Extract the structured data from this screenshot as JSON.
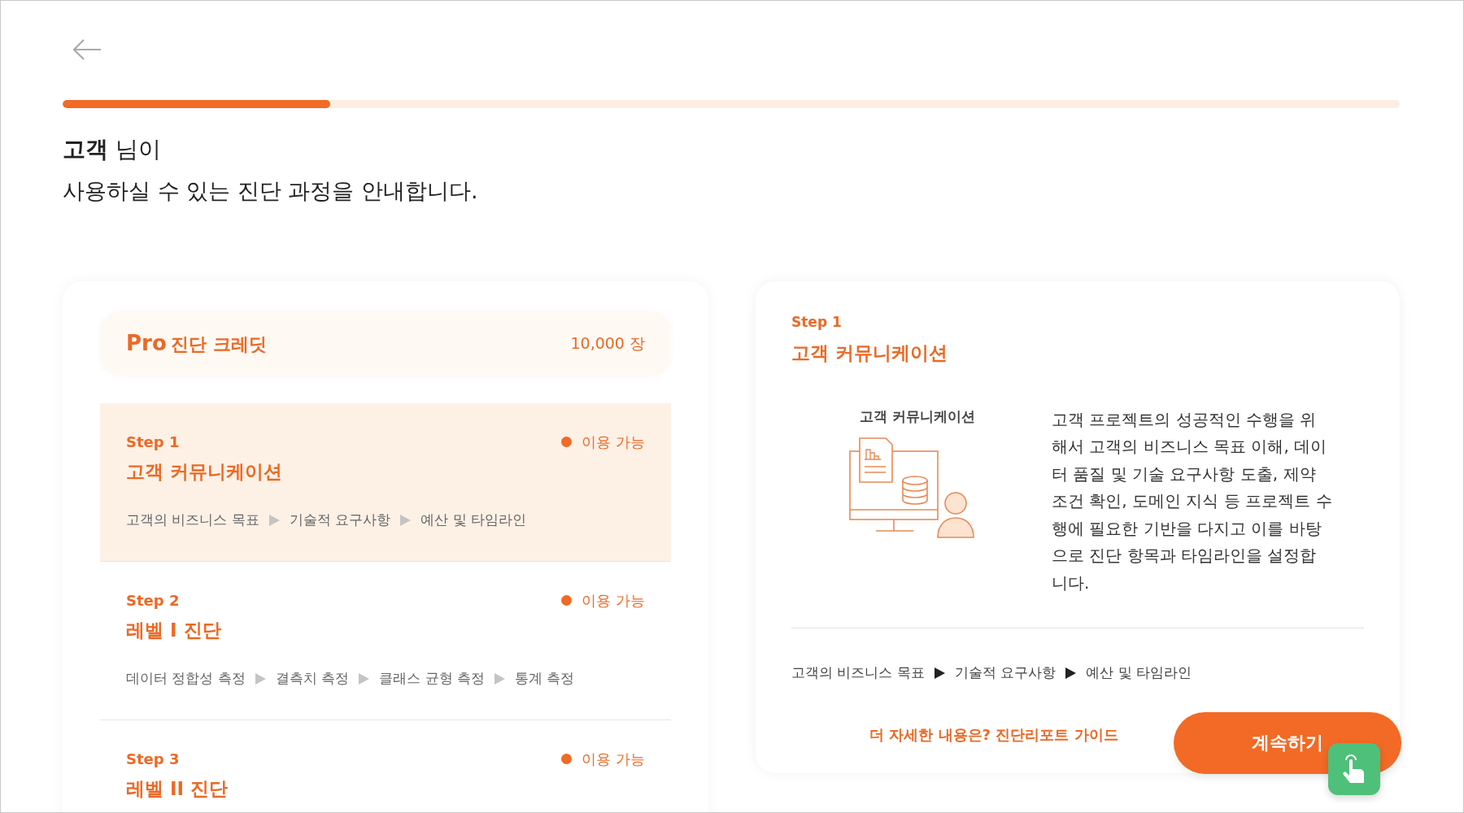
{
  "progress": {
    "level": 0.2
  },
  "greeting": {
    "name": "고객",
    "suffix": "님이",
    "subtitle": "사용하실 수 있는 진단 과정을 안내합니다."
  },
  "credit": {
    "plan": "Pro",
    "label": "진단 크레딧",
    "amount": "10,000 장"
  },
  "steps": [
    {
      "step": "Step 1",
      "title": "고객 커뮤니케이션",
      "status": "이용 가능",
      "selected": true,
      "tasks": [
        "고객의 비즈니스 목표",
        "기술적 요구사항",
        "예산 및 타임라인"
      ]
    },
    {
      "step": "Step 2",
      "title": "레벨 I 진단",
      "status": "이용 가능",
      "selected": false,
      "tasks": [
        "데이터 정합성 측정",
        "결측치 측정",
        "클래스 균형 측정",
        "통계 측정"
      ]
    },
    {
      "step": "Step 3",
      "title": "레벨 II 진단",
      "status": "이용 가능",
      "selected": false
    }
  ],
  "detail": {
    "step": "Step 1",
    "title": "고객 커뮤니케이션",
    "illustration_label": "고객 커뮤니케이션",
    "description": "고객 프로젝트의 성공적인 수행을 위해서 고객의 비즈니스 목표 이해, 데이터 품질 및 기술 요구사항 도출, 제약 조건 확인, 도메인 지식 등 프로젝트 수행에 필요한 기반을 다지고 이를 바탕으로 진단 항목과 타임라인을 설정합니다.",
    "tasks": [
      "고객의 비즈니스 목표",
      "기술적 요구사항",
      "예산 및 타임라인"
    ]
  },
  "guide_link": "더 자세한 내용은? 진단리포트 가이드",
  "continue_button": "계속하기"
}
